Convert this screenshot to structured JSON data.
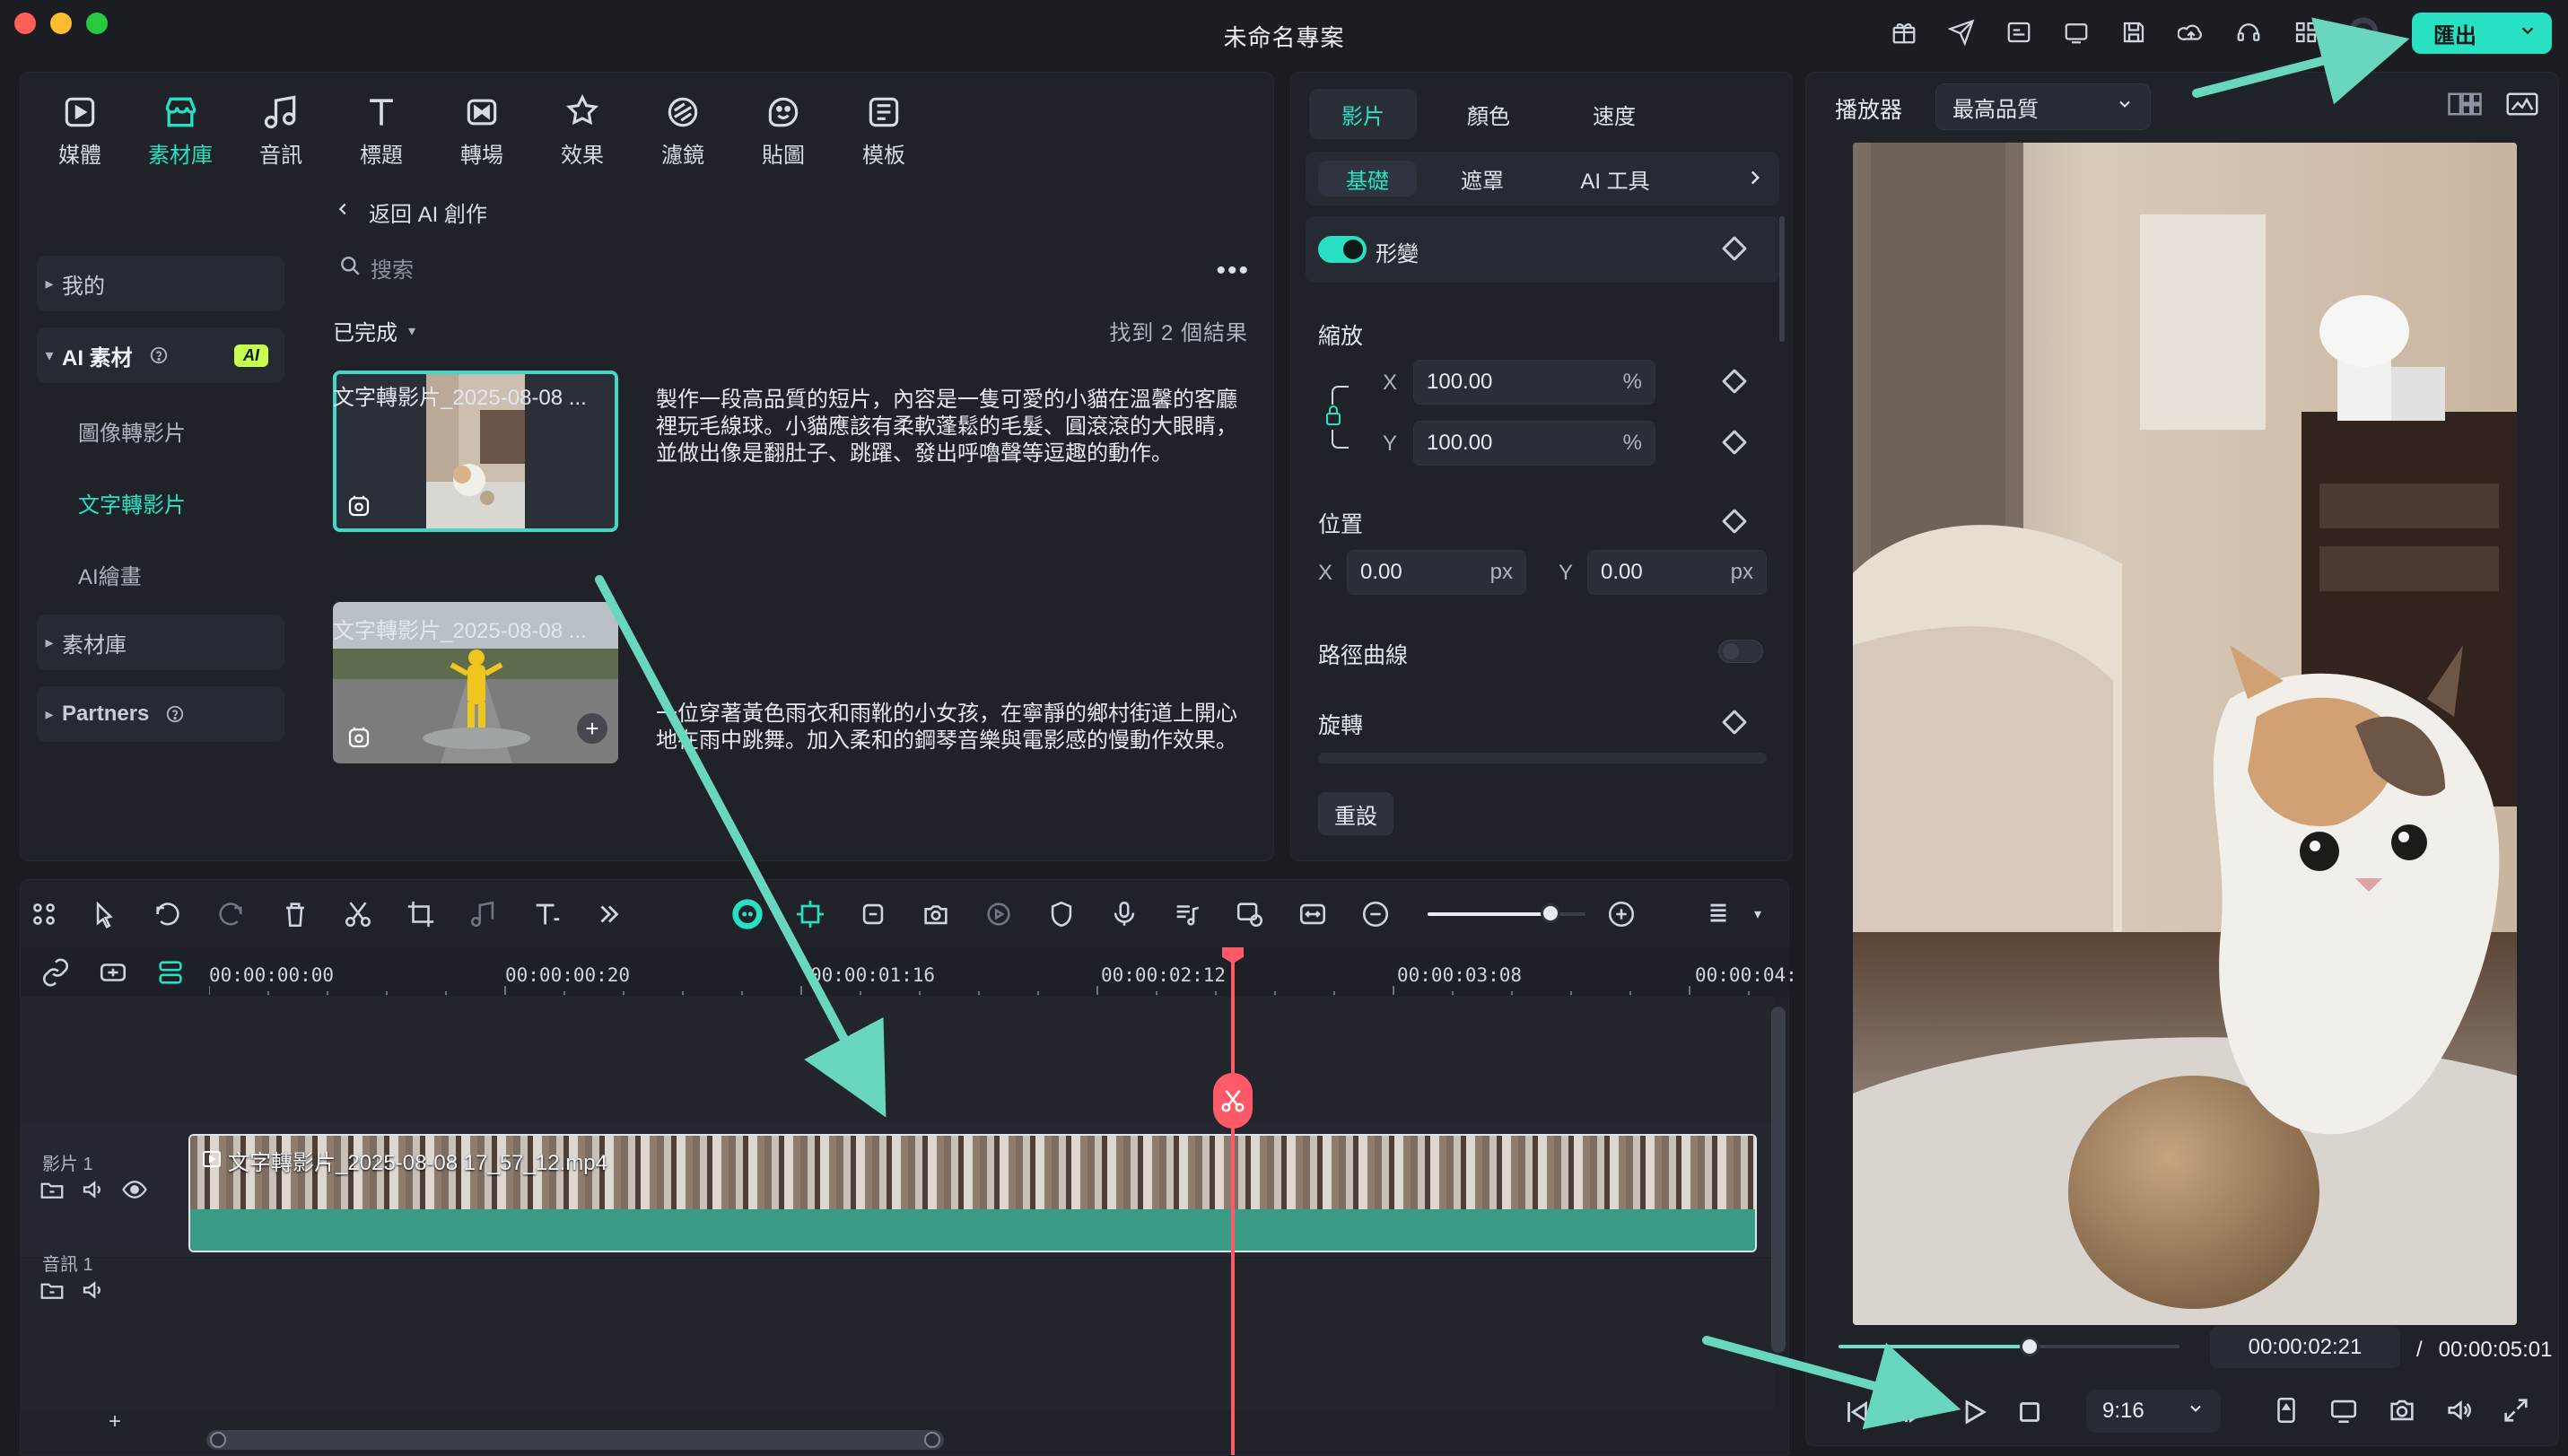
{
  "window": {
    "title": "未命名專案",
    "export_label": "匯出"
  },
  "colors": {
    "accent": "#28e1c2",
    "danger": "#ff5a68"
  },
  "toolbar_icons": [
    "gift-icon",
    "send-icon",
    "subtitle-icon",
    "monitor-icon",
    "save-icon",
    "cloud-upload-icon",
    "headset-icon",
    "grid-icon",
    "avatar-icon"
  ],
  "library": {
    "tabs": [
      {
        "label": "媒體",
        "icon": "media-icon"
      },
      {
        "label": "素材庫",
        "icon": "store-icon"
      },
      {
        "label": "音訊",
        "icon": "music-icon"
      },
      {
        "label": "標題",
        "icon": "title-icon"
      },
      {
        "label": "轉場",
        "icon": "transition-icon"
      },
      {
        "label": "效果",
        "icon": "effects-icon"
      },
      {
        "label": "濾鏡",
        "icon": "filter-icon"
      },
      {
        "label": "貼圖",
        "icon": "sticker-icon"
      },
      {
        "label": "模板",
        "icon": "template-icon"
      }
    ],
    "sidebar": {
      "items": [
        {
          "label": "我的"
        },
        {
          "label": "AI 素材",
          "badge": "AI"
        },
        {
          "label": "圖像轉影片"
        },
        {
          "label": "文字轉影片"
        },
        {
          "label": "AI繪畫"
        },
        {
          "label": "素材庫"
        },
        {
          "label": "Partners"
        }
      ]
    },
    "content": {
      "back_label": "返回 AI 創作",
      "search_placeholder": "搜索",
      "status_label": "已完成",
      "result_count": "找到 2 個結果",
      "items": [
        {
          "label": "文字轉影片_2025-08-08 ...",
          "description": "製作一段高品質的短片，內容是一隻可愛的小貓在溫馨的客廳裡玩毛線球。小貓應該有柔軟蓬鬆的毛髮、圓滾滾的大眼睛，並做出像是翻肚子、跳躍、發出呼嚕聲等逗趣的動作。"
        },
        {
          "label": "文字轉影片_2025-08-08 ...",
          "description": "一位穿著黃色雨衣和雨靴的小女孩，在寧靜的鄉村街道上開心地在雨中跳舞。加入柔和的鋼琴音樂與電影感的慢動作效果。"
        }
      ]
    }
  },
  "properties": {
    "tabs": [
      "影片",
      "顏色",
      "速度"
    ],
    "subtabs": [
      "基礎",
      "遮罩",
      "AI 工具"
    ],
    "transform_label": "形變",
    "scale": {
      "label": "縮放",
      "x_label": "X",
      "y_label": "Y",
      "x_value": "100.00",
      "y_value": "100.00",
      "unit": "%"
    },
    "position": {
      "label": "位置",
      "x_label": "X",
      "y_label": "Y",
      "x_value": "0.00",
      "y_value": "0.00",
      "unit": "px"
    },
    "path_curve_label": "路徑曲線",
    "rotate_label": "旋轉",
    "reset_label": "重設"
  },
  "player": {
    "title": "播放器",
    "quality": "最高品質",
    "current_time": "00:00:02:21",
    "separator": "/",
    "total_time": "00:00:05:01",
    "aspect_ratio": "9:16",
    "progress_fraction": 0.56
  },
  "timeline": {
    "ruler": [
      "00:00:00:00",
      "00:00:00:20",
      "00:00:01:16",
      "00:00:02:12",
      "00:00:03:08",
      "00:00:04:"
    ],
    "tracks": {
      "video_label": "影片 1",
      "audio_label": "音訊 1"
    },
    "clip_title": "文字轉影片_2025-08-08 17_57_12.mp4",
    "add_label": "+",
    "zoom_fraction": 0.78
  }
}
